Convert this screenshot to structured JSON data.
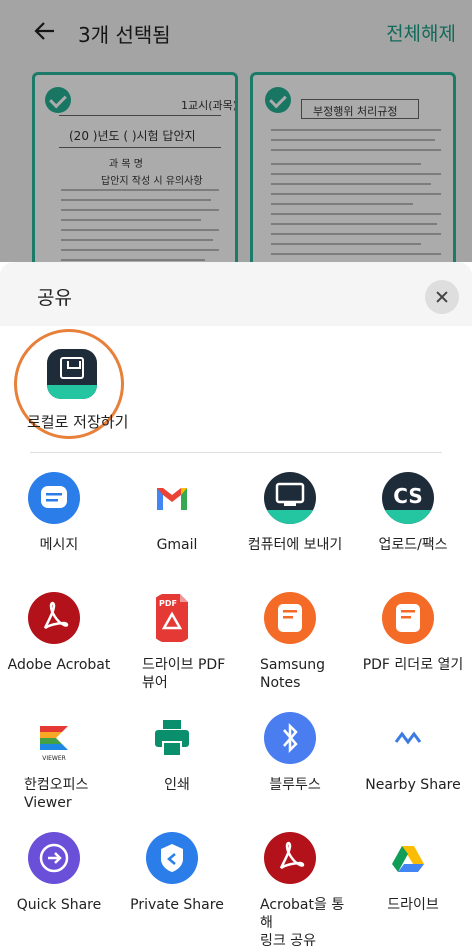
{
  "topbar": {
    "title": "3개 선택됨",
    "deselect_label": "전체해제"
  },
  "thumbnails": {
    "left": {
      "header": "1교시(과목)",
      "title": "(20 )년도 (        )시험 답안지",
      "subject": "과 목 명",
      "notice": "답안지 작성 시 유의사항"
    },
    "right": {
      "title": "부정행위 처리규정"
    }
  },
  "sheet": {
    "title": "공유",
    "local_save_label": "로컬로 저장하기",
    "apps": [
      {
        "label": "메시지",
        "icon": "message-icon"
      },
      {
        "label": "Gmail",
        "icon": "gmail-icon"
      },
      {
        "label": "컴퓨터에 보내기",
        "icon": "computer-icon"
      },
      {
        "label": "업로드/팩스",
        "icon": "camscanner-icon"
      },
      {
        "label": "Adobe Acrobat",
        "icon": "acrobat-icon"
      },
      {
        "label": "드라이브 PDF\n뷰어",
        "icon": "drive-pdf-icon"
      },
      {
        "label": "Samsung\nNotes",
        "icon": "samsung-notes-icon"
      },
      {
        "label": "PDF 리더로 열기",
        "icon": "pdf-reader-icon"
      },
      {
        "label": "한컴오피스\nViewer",
        "icon": "hancom-viewer-icon"
      },
      {
        "label": "인쇄",
        "icon": "print-icon"
      },
      {
        "label": "블루투스",
        "icon": "bluetooth-icon"
      },
      {
        "label": "Nearby Share",
        "icon": "nearby-share-icon"
      },
      {
        "label": "Quick Share",
        "icon": "quick-share-icon"
      },
      {
        "label": "Private Share",
        "icon": "private-share-icon"
      },
      {
        "label": "Acrobat을 통해\n링크 공유",
        "icon": "acrobat-link-icon"
      },
      {
        "label": "드라이브",
        "icon": "google-drive-icon"
      }
    ]
  },
  "colors": {
    "accent": "#1a9e86",
    "highlight_ring": "#e8803a"
  }
}
